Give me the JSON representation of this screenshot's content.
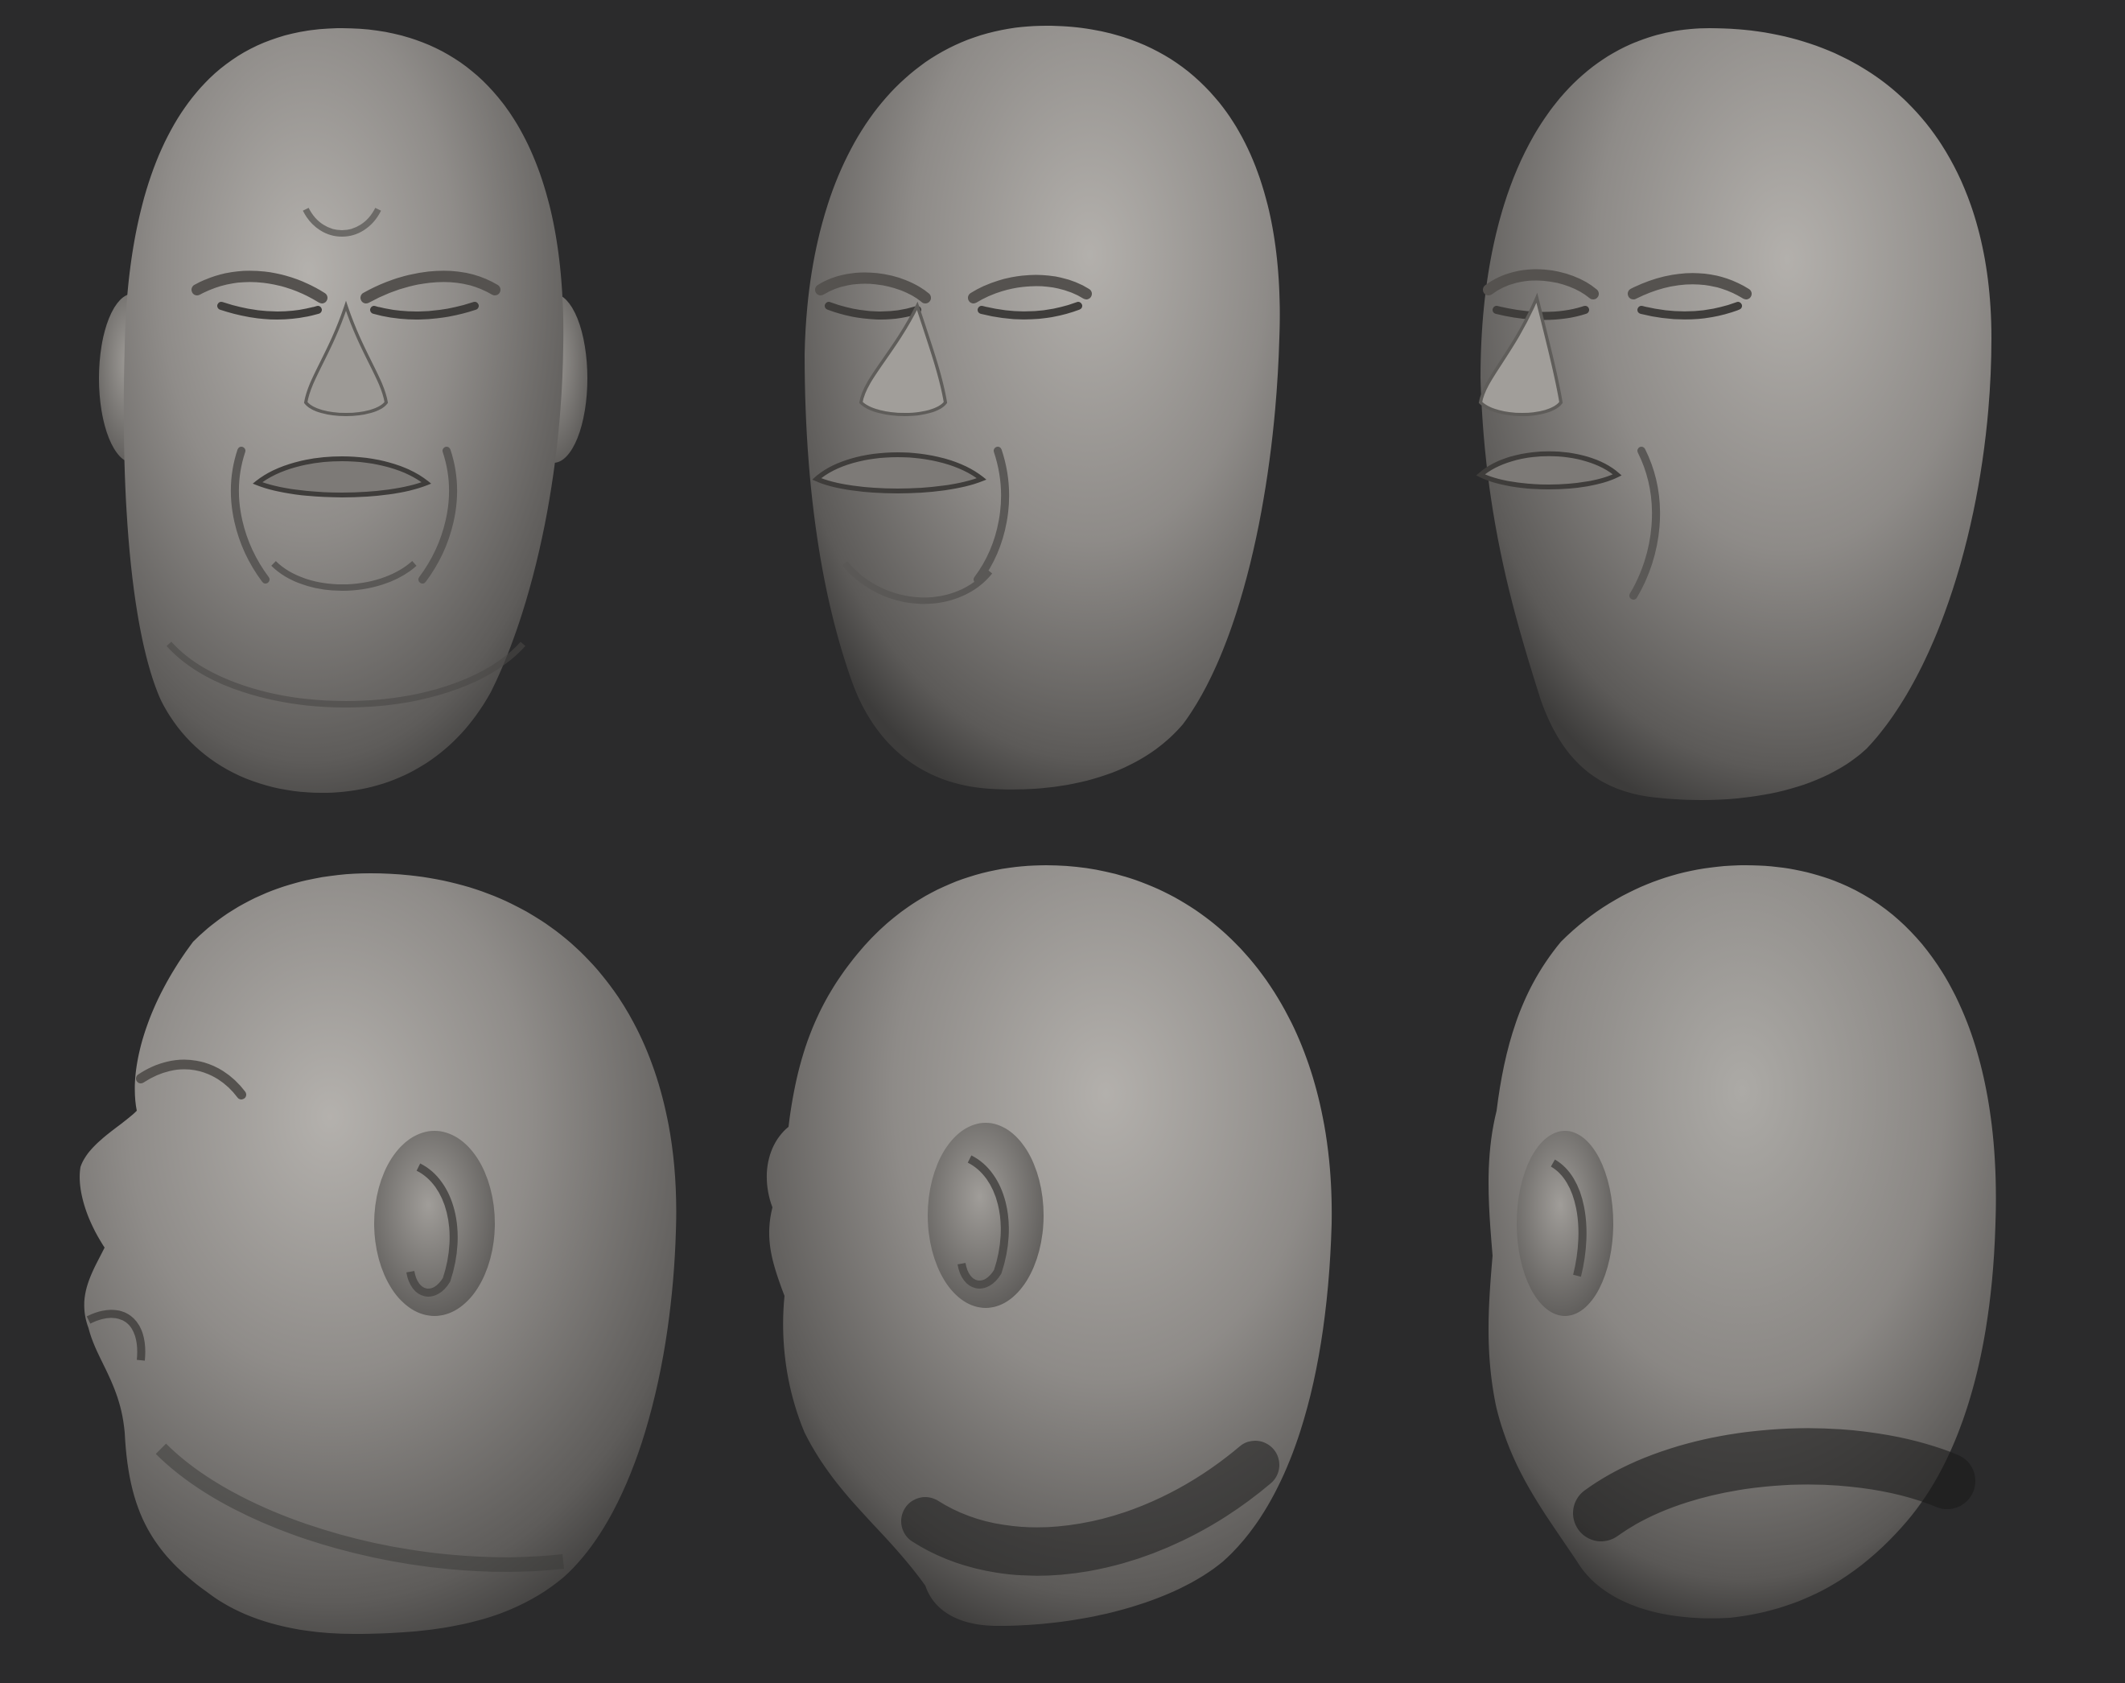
{
  "scene": {
    "background_color": "#2b2b2c",
    "material_color": "#8c8a87",
    "subject": "bald-head-sculpt",
    "grid": {
      "rows": 2,
      "columns": 3
    },
    "views": [
      {
        "id": "front",
        "row": 1,
        "column": 1
      },
      {
        "id": "three-quarter-left",
        "row": 1,
        "column": 2
      },
      {
        "id": "left-profile-turn",
        "row": 1,
        "column": 3
      },
      {
        "id": "left-side",
        "row": 2,
        "column": 1
      },
      {
        "id": "rear-left",
        "row": 2,
        "column": 2
      },
      {
        "id": "rear",
        "row": 2,
        "column": 3
      }
    ]
  }
}
